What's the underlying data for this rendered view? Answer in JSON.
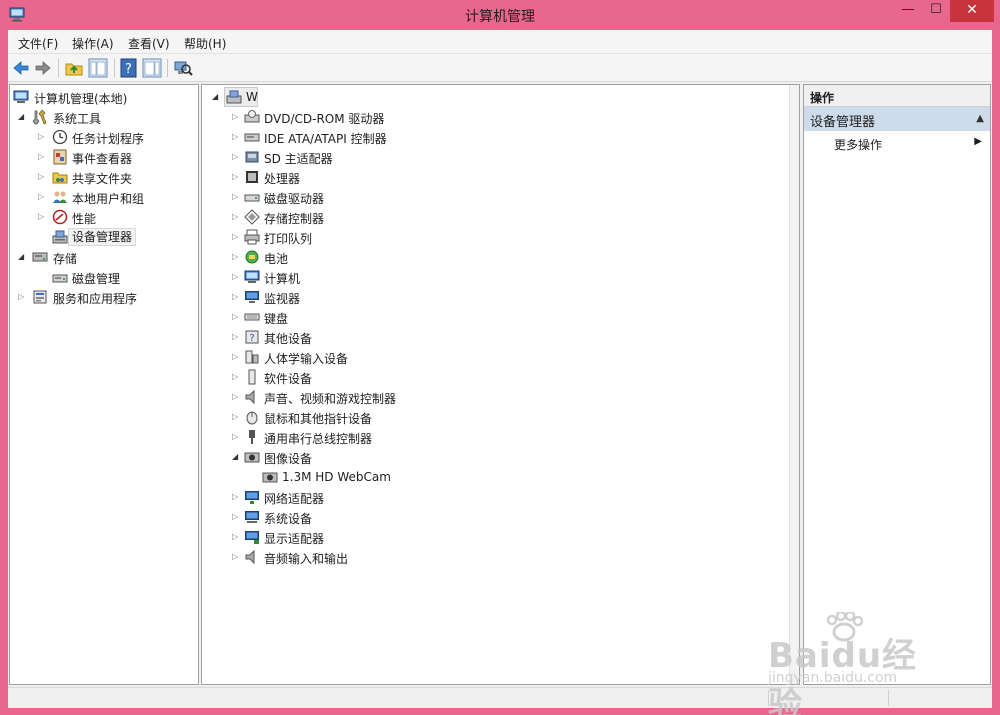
{
  "window": {
    "title": "计算机管理"
  },
  "menu": [
    "文件(F)",
    "操作(A)",
    "查看(V)",
    "帮助(H)"
  ],
  "toolbar": {
    "buttons": [
      "back-icon",
      "forward-icon",
      "up-folder-icon",
      "show-hide-tree-icon",
      "help-icon",
      "show-hide-action-pane-icon",
      "scan-hardware-icon"
    ]
  },
  "left_tree": {
    "root": "计算机管理(本地)",
    "system_tools": "系统工具",
    "system_children": [
      "任务计划程序",
      "事件查看器",
      "共享文件夹",
      "本地用户和组",
      "性能",
      "设备管理器"
    ],
    "storage": "存储",
    "storage_children": [
      "磁盘管理"
    ],
    "services": "服务和应用程序"
  },
  "device_tree": {
    "root": "W",
    "categories": [
      "DVD/CD-ROM 驱动器",
      "IDE ATA/ATAPI 控制器",
      "SD 主适配器",
      "处理器",
      "磁盘驱动器",
      "存储控制器",
      "打印队列",
      "电池",
      "计算机",
      "监视器",
      "键盘",
      "其他设备",
      "人体学输入设备",
      "软件设备",
      "声音、视频和游戏控制器",
      "鼠标和其他指针设备",
      "通用串行总线控制器",
      "图像设备"
    ],
    "imaging_child": "1.3M HD WebCam",
    "categories_after": [
      "网络适配器",
      "系统设备",
      "显示适配器",
      "音频输入和输出"
    ]
  },
  "actions": {
    "header": "操作",
    "section": "设备管理器",
    "more": "更多操作"
  },
  "watermark": {
    "main": "Baidu经验",
    "url": "jingyan.baidu.com"
  },
  "colors": {
    "window_frame": "#e8678f",
    "close_button": "#c7343b",
    "section_header": "#cddbea",
    "selection": "#f2f2f2"
  }
}
